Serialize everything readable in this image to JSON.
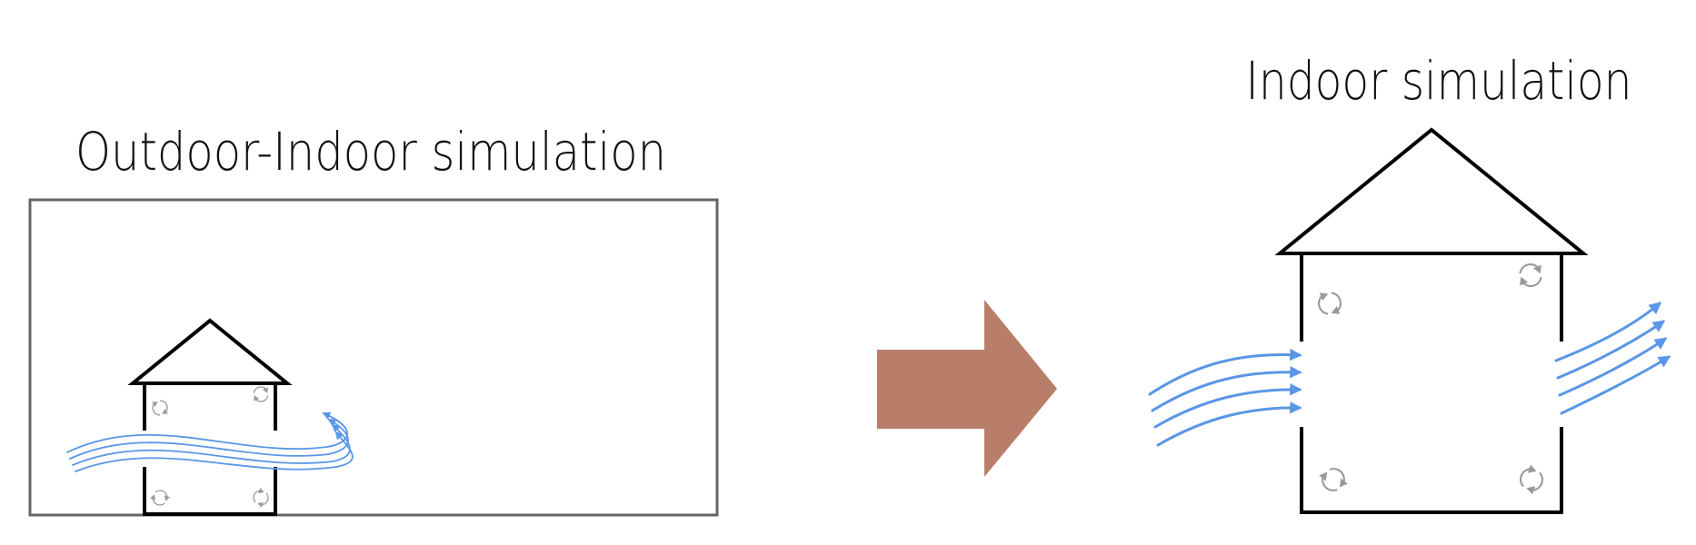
{
  "left_panel": {
    "title": "Outdoor-Indoor simulation"
  },
  "right_panel": {
    "title": "Indoor simulation"
  },
  "colors": {
    "wall": "#000000",
    "domain_border": "#666666",
    "airflow": "#5a96e6",
    "eddy": "#9a9a9a",
    "transition_arrow": "#b97e69"
  },
  "icons": {
    "transition": "right-arrow",
    "airflow": "streamline-arrows",
    "turbulence": "circular-eddy-arrows"
  }
}
